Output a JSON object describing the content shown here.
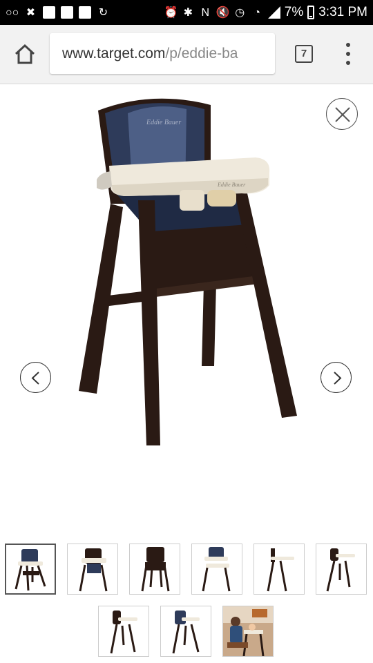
{
  "status_bar": {
    "battery_percent": "7%",
    "time": "3:31 PM",
    "left_icons": [
      "voicemail-icon",
      "missed-call-icon",
      "image-icon",
      "facebook-icon",
      "facebook-icon",
      "sync-icon"
    ],
    "right_icons": [
      "alarm-icon",
      "bluetooth-icon",
      "nfc-icon",
      "mute-icon",
      "clock-icon",
      "wifi-icon",
      "signal-icon",
      "battery-icon"
    ]
  },
  "browser": {
    "url_host": "www.target.com",
    "url_path": "/p/eddie-ba",
    "tab_count": "7"
  },
  "gallery": {
    "thumbnail_count": 9,
    "selected_index": 0,
    "thumbnails": [
      {
        "name": "thumbnail-1",
        "selected": true
      },
      {
        "name": "thumbnail-2",
        "selected": false
      },
      {
        "name": "thumbnail-3",
        "selected": false
      },
      {
        "name": "thumbnail-4",
        "selected": false
      },
      {
        "name": "thumbnail-5",
        "selected": false
      },
      {
        "name": "thumbnail-6",
        "selected": false
      },
      {
        "name": "thumbnail-7",
        "selected": false
      },
      {
        "name": "thumbnail-8",
        "selected": false
      },
      {
        "name": "thumbnail-9",
        "selected": false
      }
    ]
  },
  "colors": {
    "wood": "#2a1a14",
    "cushion": "#2e3b5a",
    "tray": "#efe9dc"
  }
}
